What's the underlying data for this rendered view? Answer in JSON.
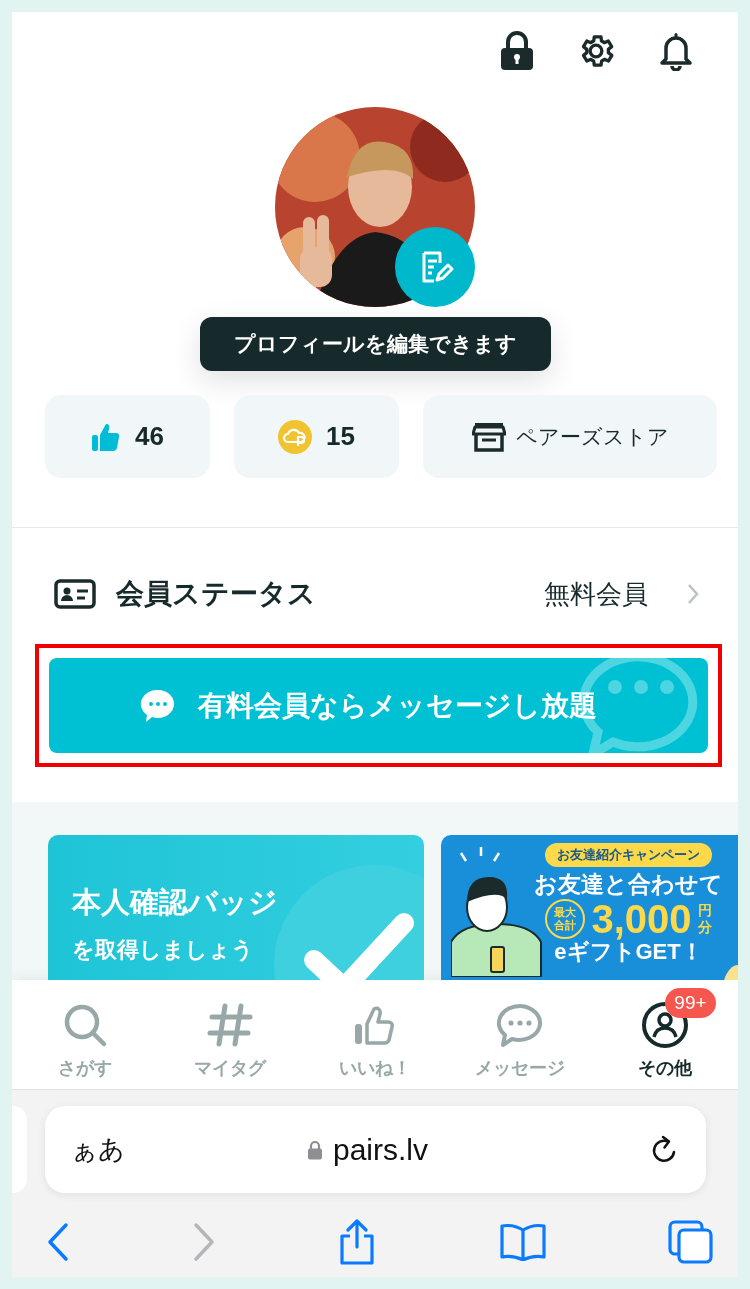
{
  "profile": {
    "tooltip": "プロフィールを編集できます"
  },
  "stats": [
    {
      "kind": "likes",
      "label": "46"
    },
    {
      "kind": "points",
      "label": "15"
    },
    {
      "kind": "store",
      "label": "ペアーズストア"
    }
  ],
  "membership": {
    "label": "会員ステータス",
    "value": "無料会員"
  },
  "promo_button": {
    "label": "有料会員ならメッセージし放題",
    "highlighted": true
  },
  "banners": [
    {
      "kind": "verify",
      "title": "本人確認バッジ",
      "subtitle": "を取得しましょう"
    },
    {
      "kind": "referral",
      "tag": "お友達紹介キャンペーン",
      "headline": "お友達と合わせて",
      "prefix": [
        "最大",
        "合計"
      ],
      "amount": "3,000",
      "unit": [
        "円",
        "分"
      ],
      "footer": "eギフトGET！"
    }
  ],
  "tab_bar": [
    {
      "kind": "search",
      "label": "さがす",
      "selected": false
    },
    {
      "kind": "tag",
      "label": "マイタグ",
      "selected": false
    },
    {
      "kind": "like",
      "label": "いいね！",
      "selected": false
    },
    {
      "kind": "message",
      "label": "メッセージ",
      "selected": false
    },
    {
      "kind": "other",
      "label": "その他",
      "selected": true,
      "badge": "99+"
    }
  ],
  "browser": {
    "text_size": "ぁあ",
    "url": "pairs.lv"
  }
}
